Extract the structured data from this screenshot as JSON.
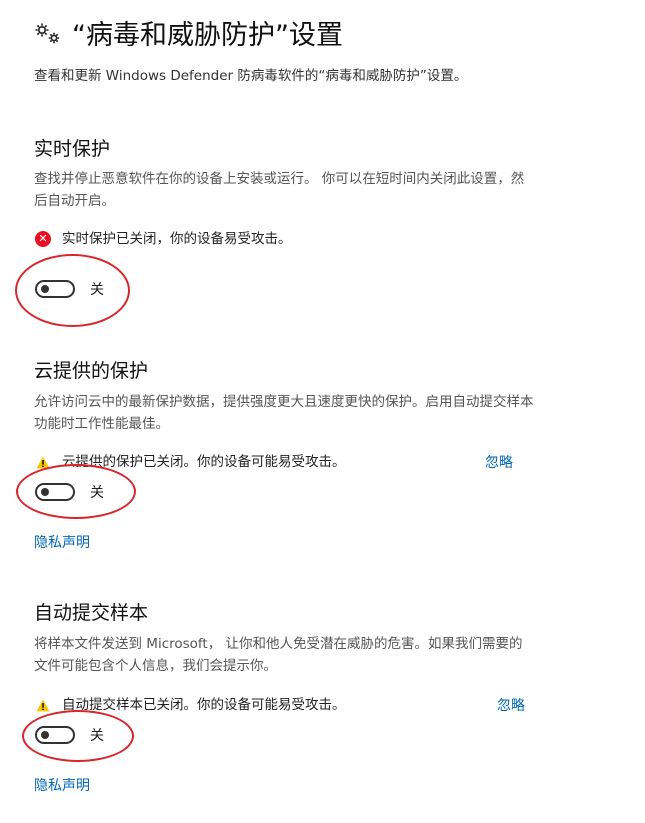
{
  "header": {
    "icon": "gears-icon",
    "title": "“病毒和威胁防护”设置",
    "description": "查看和更新 Windows Defender 防病毒软件的“病毒和威胁防护”设置。"
  },
  "sections": [
    {
      "title": "实时保护",
      "description": "查找并停止恶意软件在你的设备上安装或运行。 你可以在短时间内关闭此设置，然后自动开启。",
      "status": {
        "icon": "error-icon",
        "text": "实时保护已关闭，你的设备易受攻击。"
      },
      "toggle": {
        "state": "off",
        "label": "关"
      }
    },
    {
      "title": "云提供的保护",
      "description": "允许访问云中的最新保护数据，提供强度更大且速度更快的保护。启用自动提交样本功能时工作性能最佳。",
      "status": {
        "icon": "warning-icon",
        "text": "云提供的保护已关闭。你的设备可能易受攻击。",
        "dismiss": "忽略"
      },
      "toggle": {
        "state": "off",
        "label": "关"
      },
      "privacy_link": "隐私声明"
    },
    {
      "title": "自动提交样本",
      "description": "将样本文件发送到 Microsoft， 让你和他人免受潜在威胁的危害。如果我们需要的文件可能包含个人信息，我们会提示你。",
      "status": {
        "icon": "warning-icon",
        "text": "自动提交样本已关闭。你的设备可能易受攻击。",
        "dismiss": "忽略"
      },
      "toggle": {
        "state": "off",
        "label": "关"
      },
      "privacy_link": "隐私声明"
    }
  ],
  "colors": {
    "link": "#0067b8",
    "error": "#e81123",
    "warning": "#f7c600",
    "annotation": "#d9262a"
  }
}
